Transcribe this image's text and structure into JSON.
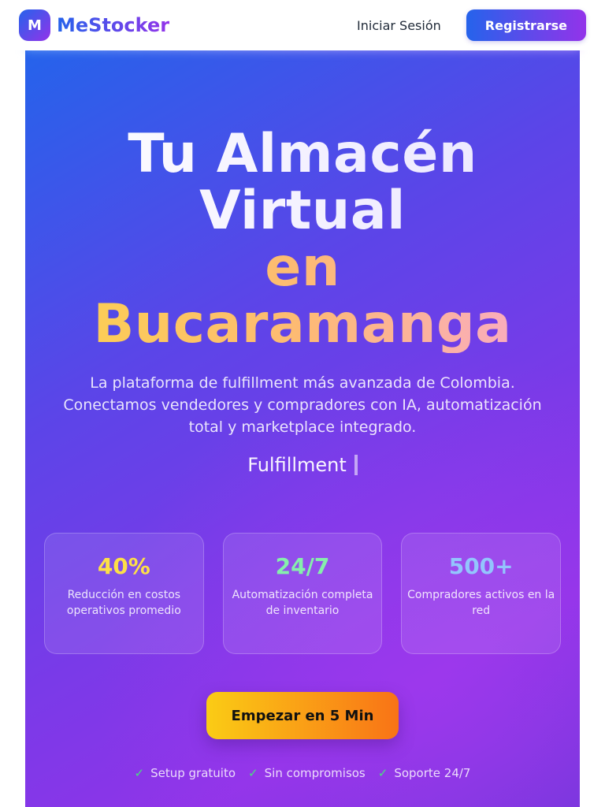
{
  "nav": {
    "logo_letter": "M",
    "brand": "MeStocker",
    "login_label": "Iniciar Sesión",
    "register_label": "Registrarse"
  },
  "hero": {
    "title_lines": [
      "Tu Almacén",
      "Virtual",
      "en",
      "Bucaramanga"
    ],
    "subtitle": "La plataforma de fulfillment más avanzada de Colombia. Conectamos vendedores y compradores con IA, automatización total y marketplace integrado.",
    "typing_text": "Fulfillment",
    "stats": [
      {
        "value": "40%",
        "label": "Reducción en costos operativos promedio",
        "color": "#fde047"
      },
      {
        "value": "24/7",
        "label": "Automatización completa de inventario",
        "color": "#86efac"
      },
      {
        "value": "500+",
        "label": "Compradores activos en la red",
        "color": "#93c5fd"
      }
    ],
    "cta_label": "Empezar en 5 Min",
    "perks": [
      "Setup gratuito",
      "Sin compromisos",
      "Soporte 24/7"
    ],
    "check_icon": "✓"
  },
  "colors": {
    "brand_blue": "#2563eb",
    "brand_purple": "#9333ea",
    "cta_yellow": "#facc15",
    "cta_orange": "#f97316"
  }
}
